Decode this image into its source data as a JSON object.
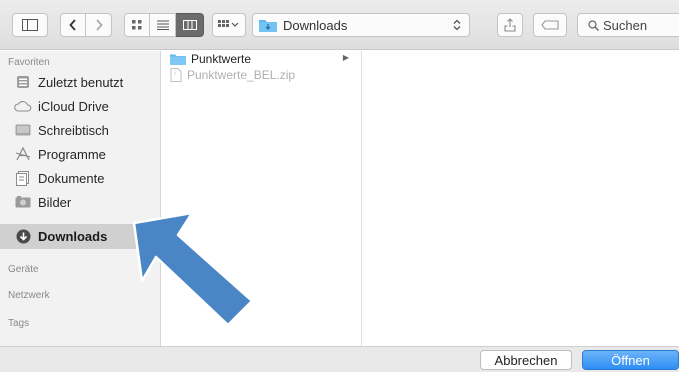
{
  "toolbar": {
    "path_folder": "Downloads",
    "search_placeholder": "Suchen"
  },
  "sidebar": {
    "favorites_title": "Favoriten",
    "items": [
      {
        "label": "Zuletzt benutzt",
        "icon": "recents-icon"
      },
      {
        "label": "iCloud Drive",
        "icon": "icloud-icon"
      },
      {
        "label": "Schreibtisch",
        "icon": "desktop-icon"
      },
      {
        "label": "Programme",
        "icon": "applications-icon"
      },
      {
        "label": "Dokumente",
        "icon": "documents-icon"
      },
      {
        "label": "Bilder",
        "icon": "pictures-icon"
      },
      {
        "label": "Downloads",
        "icon": "downloads-icon",
        "selected": true
      }
    ],
    "devices_title": "Geräte",
    "network_title": "Netzwerk",
    "tags_title": "Tags"
  },
  "browser": {
    "column1": [
      {
        "name": "Punktwerte",
        "type": "folder",
        "enabled": true
      },
      {
        "name": "Punktwerte_BEL.zip",
        "type": "zip",
        "enabled": false
      }
    ]
  },
  "buttons": {
    "cancel": "Abbrechen",
    "open": "Öffnen"
  },
  "colors": {
    "accent": "#2e8ef3",
    "annotation_arrow": "#4a86c5",
    "sidebar_selected": "#d0d0d0"
  }
}
